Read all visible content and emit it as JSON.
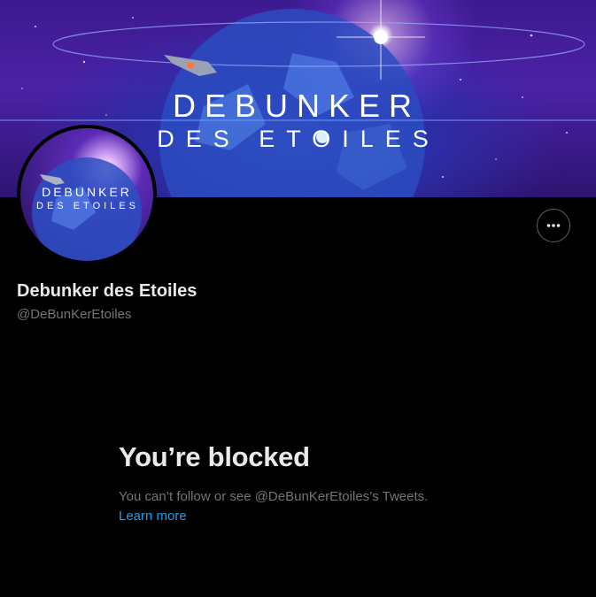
{
  "banner": {
    "title_line1": "DEBUNKER",
    "title_line2": "DES ETOILES"
  },
  "avatar": {
    "title_line1": "DEBUNKER",
    "title_line2": "DES ETOILES"
  },
  "profile": {
    "name": "Debunker des Etoiles",
    "handle": "@DeBunKerEtoiles"
  },
  "actions": {
    "more_icon": "more-horizontal-icon"
  },
  "blocked": {
    "title": "You’re blocked",
    "message": "You can’t follow or see @DeBunKerEtoiles’s Tweets.",
    "learn_more": "Learn more"
  },
  "colors": {
    "background": "#000000",
    "link": "#1d9bf0",
    "secondary_text": "#71767b",
    "primary_text": "#e7e9ea"
  }
}
